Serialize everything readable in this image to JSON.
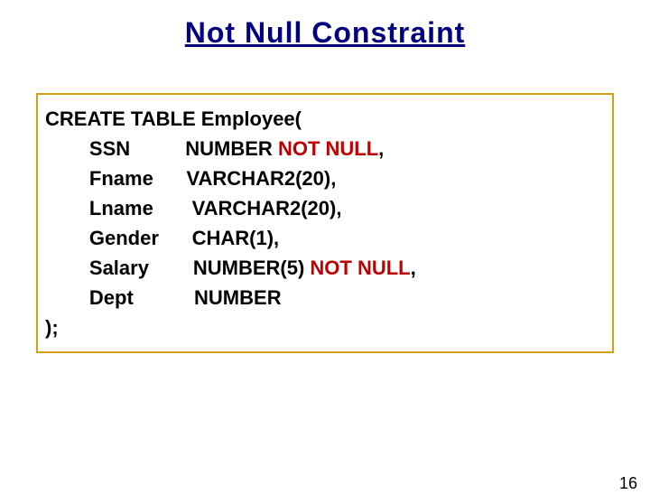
{
  "title": "Not Null Constraint",
  "code": {
    "l1": "CREATE TABLE Employee(",
    "l2_name": "        SSN",
    "l2_type": "          NUMBER ",
    "l2_hl": "NOT NULL",
    "l2_end": ",",
    "l3_name": "        Fname",
    "l3_type": "      VARCHAR2(20),",
    "l4_name": "        Lname",
    "l4_type": "       VARCHAR2(20),",
    "l5_name": "        Gender",
    "l5_type": "      CHAR(1),",
    "l6_name": "        Salary",
    "l6_type": "        NUMBER(5) ",
    "l6_hl": "NOT NULL",
    "l6_end": ",",
    "l7_name": "        Dept",
    "l7_type": "           NUMBER",
    "l8": ");"
  },
  "page_number": "16"
}
